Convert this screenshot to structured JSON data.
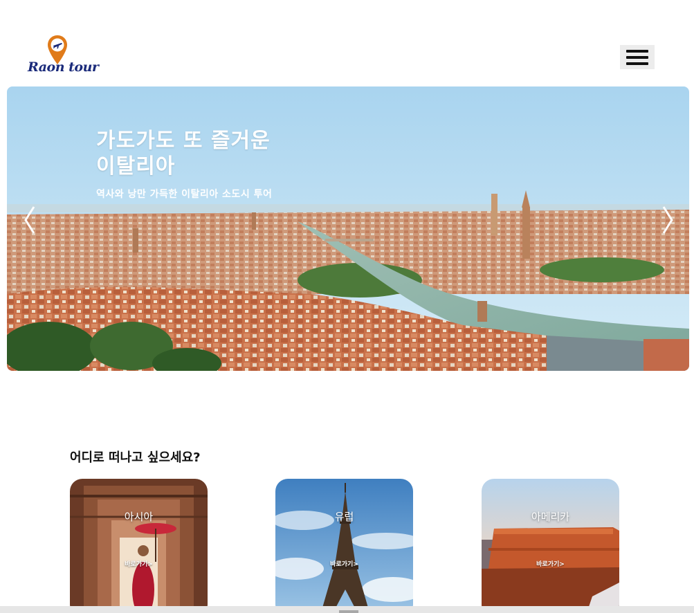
{
  "header": {
    "logo_text": "Raon tour",
    "menu_icon": "hamburger-icon"
  },
  "hero": {
    "title_line1": "가도가도 또 즐거운",
    "title_line2": "이탈리아",
    "subtitle": "역사와 낭만 가득한 이탈리아 소도시 투어",
    "prev_icon": "chevron-left-icon",
    "next_icon": "chevron-right-icon"
  },
  "destinations": {
    "heading": "어디로 떠나고 싶으세요?",
    "cards": [
      {
        "title": "아시아",
        "link": "바로가기>"
      },
      {
        "title": "유럽",
        "link": "바로가기>"
      },
      {
        "title": "아메리카",
        "link": "바로가기>"
      }
    ]
  },
  "colors": {
    "logo_text": "#1a2a7a",
    "logo_pin": "#e07b1a",
    "menu_bg": "#ececec"
  }
}
